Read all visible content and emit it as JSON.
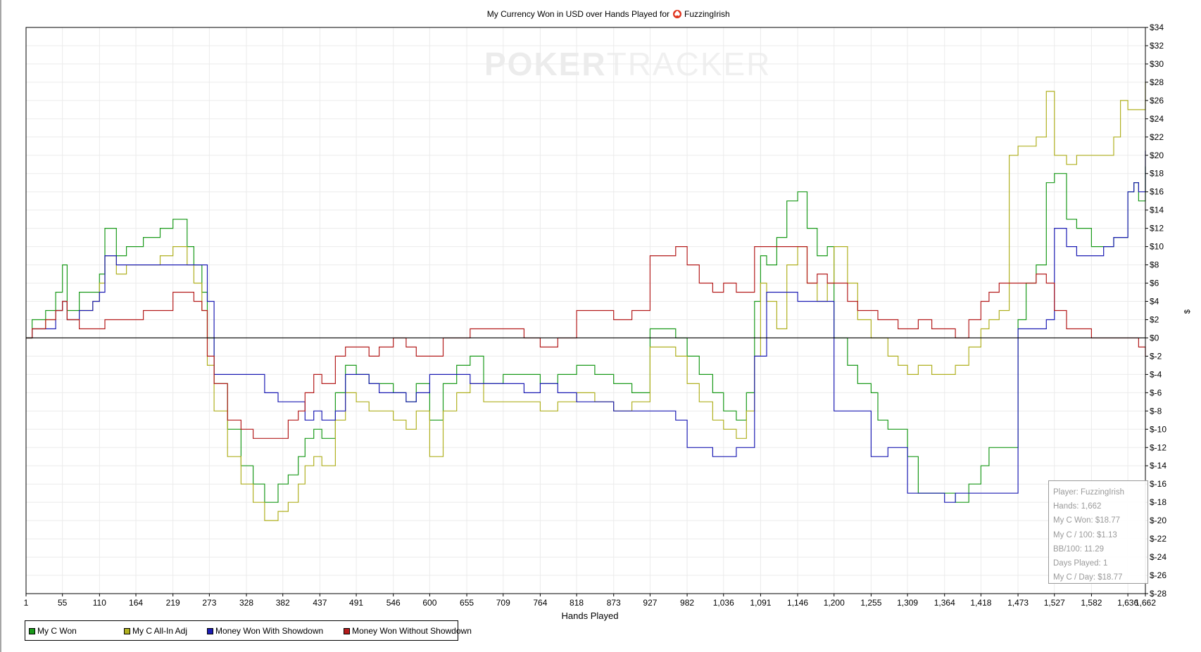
{
  "chart_data": {
    "type": "line",
    "title": "My Currency Won in USD over Hands Played for",
    "title_player": "FuzzingIrish",
    "title_icon": "poker-spade-chip-icon",
    "xlabel": "Hands Played",
    "ylabel": "$",
    "xlim": [
      1,
      1662
    ],
    "ylim": [
      -28,
      34
    ],
    "x_ticks": [
      1,
      55,
      110,
      164,
      219,
      273,
      328,
      382,
      437,
      491,
      546,
      600,
      655,
      709,
      764,
      818,
      873,
      927,
      982,
      1036,
      1091,
      1146,
      1200,
      1255,
      1309,
      1364,
      1418,
      1473,
      1527,
      1582,
      1636,
      1662
    ],
    "x_tick_labels": [
      "1",
      "55",
      "110",
      "164",
      "219",
      "273",
      "328",
      "382",
      "437",
      "491",
      "546",
      "600",
      "655",
      "709",
      "764",
      "818",
      "873",
      "927",
      "982",
      "1,036",
      "1,091",
      "1,146",
      "1,200",
      "1,255",
      "1,309",
      "1,364",
      "1,418",
      "1,473",
      "1,527",
      "1,582",
      "1,636",
      "1,662"
    ],
    "y_ticks": [
      34,
      32,
      30,
      28,
      26,
      24,
      22,
      20,
      18,
      16,
      14,
      12,
      10,
      8,
      6,
      4,
      2,
      0,
      -2,
      -4,
      -6,
      -8,
      -10,
      -12,
      -14,
      -16,
      -18,
      -20,
      -22,
      -24,
      -26,
      -28
    ],
    "y_tick_labels": [
      "$34",
      "$32",
      "$30",
      "$28",
      "$26",
      "$24",
      "$22",
      "$20",
      "$18",
      "$16",
      "$14",
      "$12",
      "$10",
      "$8",
      "$6",
      "$4",
      "$2",
      "$0",
      "$-2",
      "$-4",
      "$-6",
      "$-8",
      "$-10",
      "$-12",
      "$-14",
      "$-16",
      "$-18",
      "$-20",
      "$-22",
      "$-24",
      "$-26",
      "$-28"
    ],
    "grid": true,
    "legend_position": "bottom-left",
    "series": [
      {
        "name": "My C Won",
        "color": "#1a9a1a",
        "x": [
          1,
          10,
          30,
          45,
          55,
          62,
          80,
          100,
          110,
          118,
          135,
          150,
          175,
          200,
          219,
          240,
          250,
          262,
          270,
          280,
          300,
          320,
          338,
          355,
          375,
          390,
          405,
          415,
          428,
          440,
          460,
          475,
          491,
          510,
          525,
          546,
          565,
          580,
          600,
          620,
          640,
          660,
          680,
          709,
          740,
          764,
          790,
          818,
          845,
          873,
          900,
          927,
          945,
          965,
          982,
          1000,
          1020,
          1036,
          1055,
          1070,
          1082,
          1091,
          1100,
          1115,
          1130,
          1146,
          1160,
          1175,
          1190,
          1200,
          1220,
          1235,
          1255,
          1265,
          1280,
          1295,
          1309,
          1325,
          1345,
          1364,
          1380,
          1400,
          1418,
          1430,
          1445,
          1460,
          1473,
          1485,
          1500,
          1515,
          1527,
          1545,
          1560,
          1582,
          1600,
          1615,
          1625,
          1636,
          1645,
          1652,
          1662
        ],
        "y": [
          0,
          2,
          3,
          5,
          8,
          3,
          5,
          5,
          7,
          12,
          9,
          10,
          11,
          12,
          13,
          10,
          8,
          5,
          0,
          -5,
          -10,
          -14,
          -16,
          -18,
          -16,
          -15,
          -13,
          -11,
          -10,
          -11,
          -6,
          -3,
          -4,
          -5,
          -5,
          -6,
          -7,
          -5,
          -9,
          -5,
          -3,
          -2,
          -5,
          -4,
          -4,
          -5,
          -4,
          -3,
          -4,
          -5,
          -6,
          1,
          1,
          0,
          -2,
          -4,
          -6,
          -8,
          -9,
          -6,
          4,
          9,
          8,
          11,
          15,
          16,
          12,
          9,
          10,
          0,
          -3,
          -5,
          -6,
          -9,
          -10,
          -10,
          -13,
          -17,
          -17,
          -17,
          -18,
          -16,
          -14,
          -12,
          -12,
          -12,
          2,
          6,
          8,
          17,
          18,
          13,
          12,
          10,
          10,
          11,
          11,
          16,
          17,
          15,
          18.77
        ]
      },
      {
        "name": "My C All-In Adj",
        "color": "#b0b020",
        "x": [
          1,
          10,
          30,
          45,
          55,
          62,
          80,
          100,
          110,
          118,
          135,
          150,
          175,
          200,
          219,
          240,
          250,
          262,
          270,
          280,
          300,
          320,
          338,
          355,
          375,
          390,
          405,
          415,
          428,
          440,
          460,
          475,
          491,
          510,
          525,
          546,
          565,
          580,
          600,
          620,
          640,
          660,
          680,
          709,
          740,
          764,
          790,
          818,
          845,
          873,
          900,
          927,
          945,
          965,
          982,
          1000,
          1020,
          1036,
          1055,
          1070,
          1082,
          1091,
          1100,
          1115,
          1130,
          1146,
          1160,
          1175,
          1190,
          1200,
          1220,
          1235,
          1255,
          1265,
          1280,
          1295,
          1309,
          1325,
          1345,
          1364,
          1380,
          1400,
          1418,
          1430,
          1445,
          1460,
          1473,
          1485,
          1500,
          1515,
          1527,
          1545,
          1560,
          1582,
          1600,
          1615,
          1625,
          1636,
          1645,
          1652,
          1662
        ],
        "y": [
          0,
          1,
          2,
          3,
          4,
          2,
          3,
          4,
          6,
          9,
          7,
          8,
          8,
          9,
          10,
          8,
          6,
          3,
          -3,
          -8,
          -13,
          -16,
          -18,
          -20,
          -19,
          -18,
          -16,
          -14,
          -13,
          -14,
          -9,
          -6,
          -7,
          -8,
          -8,
          -9,
          -10,
          -8,
          -13,
          -8,
          -6,
          -5,
          -7,
          -7,
          -7,
          -8,
          -7,
          -6,
          -7,
          -8,
          -7,
          -1,
          -1,
          -2,
          -5,
          -7,
          -9,
          -10,
          -11,
          -8,
          -2,
          6,
          4,
          1,
          8,
          10,
          6,
          4,
          6,
          10,
          6,
          2,
          0,
          0,
          -2,
          -3,
          -4,
          -3,
          -4,
          -4,
          -3,
          -1,
          1,
          2,
          3,
          20,
          21,
          21,
          22,
          27,
          20,
          19,
          20,
          20,
          20,
          22,
          26,
          25,
          25,
          25,
          28
        ]
      },
      {
        "name": "Money Won With Showdown",
        "color": "#1c1cb4",
        "x": [
          1,
          10,
          30,
          45,
          55,
          62,
          80,
          100,
          110,
          118,
          135,
          150,
          175,
          200,
          219,
          240,
          250,
          262,
          270,
          280,
          300,
          320,
          338,
          355,
          375,
          390,
          405,
          415,
          428,
          440,
          460,
          475,
          491,
          510,
          525,
          546,
          565,
          580,
          600,
          620,
          640,
          660,
          680,
          709,
          740,
          764,
          790,
          818,
          845,
          873,
          900,
          927,
          945,
          965,
          982,
          1000,
          1020,
          1036,
          1055,
          1070,
          1082,
          1091,
          1100,
          1115,
          1130,
          1146,
          1160,
          1175,
          1190,
          1200,
          1220,
          1235,
          1255,
          1265,
          1280,
          1295,
          1309,
          1325,
          1345,
          1364,
          1380,
          1400,
          1418,
          1430,
          1445,
          1460,
          1473,
          1485,
          1500,
          1515,
          1527,
          1545,
          1560,
          1582,
          1600,
          1615,
          1625,
          1636,
          1645,
          1652,
          1662
        ],
        "y": [
          0,
          1,
          1,
          3,
          4,
          2,
          3,
          4,
          5,
          9,
          8,
          8,
          8,
          8,
          8,
          8,
          8,
          8,
          4,
          -4,
          -4,
          -4,
          -4,
          -6,
          -7,
          -7,
          -7,
          -9,
          -8,
          -9,
          -8,
          -4,
          -4,
          -5,
          -6,
          -6,
          -7,
          -6,
          -4,
          -4,
          -4,
          -5,
          -5,
          -5,
          -6,
          -5,
          -6,
          -7,
          -7,
          -8,
          -8,
          -8,
          -8,
          -9,
          -12,
          -12,
          -13,
          -13,
          -12,
          -12,
          -2,
          -2,
          5,
          5,
          5,
          4,
          4,
          4,
          4,
          -8,
          -8,
          -8,
          -13,
          -13,
          -12,
          -12,
          -17,
          -17,
          -17,
          -18,
          -17,
          -17,
          -17,
          -17,
          -17,
          -17,
          1,
          1,
          1,
          2,
          12,
          10,
          9,
          9,
          10,
          11,
          11,
          16,
          17,
          16,
          20.5
        ]
      },
      {
        "name": "Money Won Without Showdown",
        "color": "#b41c1c",
        "x": [
          1,
          10,
          30,
          45,
          55,
          62,
          80,
          100,
          110,
          118,
          135,
          150,
          175,
          200,
          219,
          240,
          250,
          262,
          270,
          280,
          300,
          320,
          338,
          355,
          375,
          390,
          405,
          415,
          428,
          440,
          460,
          475,
          491,
          510,
          525,
          546,
          565,
          580,
          600,
          620,
          640,
          660,
          680,
          709,
          740,
          764,
          790,
          818,
          845,
          873,
          900,
          927,
          945,
          965,
          982,
          1000,
          1020,
          1036,
          1055,
          1070,
          1082,
          1091,
          1100,
          1115,
          1130,
          1146,
          1160,
          1175,
          1190,
          1200,
          1220,
          1235,
          1255,
          1265,
          1280,
          1295,
          1309,
          1325,
          1345,
          1364,
          1380,
          1400,
          1418,
          1430,
          1445,
          1460,
          1473,
          1485,
          1500,
          1515,
          1527,
          1545,
          1560,
          1582,
          1600,
          1615,
          1625,
          1636,
          1645,
          1652,
          1662
        ],
        "y": [
          0,
          1,
          2,
          3,
          4,
          2,
          1,
          1,
          1,
          2,
          2,
          2,
          3,
          3,
          5,
          5,
          4,
          3,
          -2,
          -5,
          -9,
          -10,
          -11,
          -11,
          -11,
          -9,
          -8,
          -6,
          -4,
          -5,
          -2,
          -1,
          -1,
          -2,
          -1,
          0,
          -1,
          -2,
          -2,
          0,
          0,
          1,
          1,
          1,
          0,
          -1,
          0,
          3,
          3,
          2,
          3,
          9,
          9,
          10,
          8,
          6,
          5,
          6,
          5,
          5,
          10,
          10,
          10,
          10,
          10,
          10,
          6,
          7,
          6,
          6,
          4,
          3,
          3,
          2,
          2,
          1,
          1,
          2,
          1,
          1,
          0,
          2,
          4,
          5,
          6,
          6,
          6,
          6,
          7,
          6,
          3,
          1,
          1,
          0,
          0,
          0,
          0,
          0,
          0,
          -1,
          -2
        ]
      }
    ]
  },
  "watermark": {
    "strong": "POKER",
    "light": "TRACKER"
  },
  "stats": {
    "player": "Player: FuzzingIrish",
    "hands": "Hands: 1,662",
    "won": "My C Won: $18.77",
    "per100": "My C / 100: $1.13",
    "bb100": "BB/100: 11.29",
    "days": "Days Played: 1",
    "per_day": "My C / Day: $18.77"
  }
}
